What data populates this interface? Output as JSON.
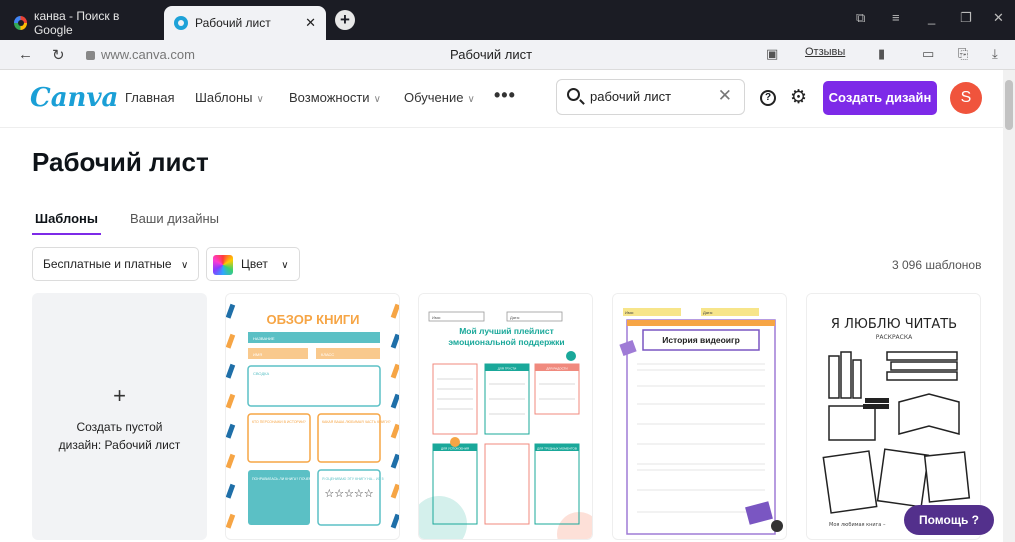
{
  "browser": {
    "tabs": [
      {
        "label": "канва - Поиск в Google"
      },
      {
        "label": "Рабочий лист"
      }
    ],
    "url": "www.canva.com",
    "page_title": "Рабочий лист",
    "reviews_label": "Отзывы"
  },
  "header": {
    "logo": "Canva",
    "menu": [
      {
        "label": "Главная"
      },
      {
        "label": "Шаблоны"
      },
      {
        "label": "Возможности"
      },
      {
        "label": "Обучение"
      }
    ],
    "more": "•••",
    "search_value": "рабочий лист",
    "help": "?",
    "create_label": "Создать дизайн",
    "avatar_letter": "S"
  },
  "page": {
    "title": "Рабочий лист",
    "tabs": [
      {
        "label": "Шаблоны"
      },
      {
        "label": "Ваши дизайны"
      }
    ],
    "filters": {
      "price": "Бесплатные и платные",
      "color": "Цвет"
    },
    "count": "3 096 шаблонов"
  },
  "cards": {
    "blank": {
      "plus": "+",
      "label": "Создать пустой дизайн: Рабочий лист"
    },
    "book_review": {
      "title": "ОБЗОР КНИГИ",
      "field_name": "НАЗВАНИЕ",
      "field_author": "ИМЯ",
      "field_class": "КЛАСС",
      "field_summary": "СВОДКА",
      "field_characters": "КТО ПЕРСОНАЖИ В ИСТОРИИ?",
      "field_favorite": "КАКАЯ ВАША ЛЮБИМАЯ ЧАСТЬ КНИГИ?",
      "field_like": "ПОНРАВИЛАСЬ ЛИ КНИГА? ПОЧЕМУ?",
      "field_rating": "Я ОЦЕНИВАЮ ЭТУ КНИГУ НА... ИЗ 5",
      "stars": "☆☆☆☆☆"
    },
    "playlist": {
      "name_label": "Имя:",
      "date_label": "Дата:",
      "title": "Мой лучший плейлист эмоциональной поддержки",
      "box1": "ДЛЯ ГРУСТИ",
      "box2": "ДЛЯ РАДОСТИ",
      "box3": "ДЛЯ УСПОКОЕНИЯ",
      "box4": "ДЛЯ ТРУДНЫХ МОМЕНТОВ"
    },
    "videogames": {
      "name_label": "Имя:",
      "date_label": "Дата:",
      "title": "История видеоигр"
    },
    "reading": {
      "title": "Я ЛЮБЛЮ ЧИТАТЬ",
      "subtitle": "РАСКРАСКА",
      "footer": "Моя любимая книга –"
    }
  },
  "help_button": "Помощь ?",
  "colors": {
    "accent": "#7d2ae8",
    "canva_blue": "#1a9fd6",
    "help_pill": "#53308c",
    "avatar": "#f0543c"
  }
}
